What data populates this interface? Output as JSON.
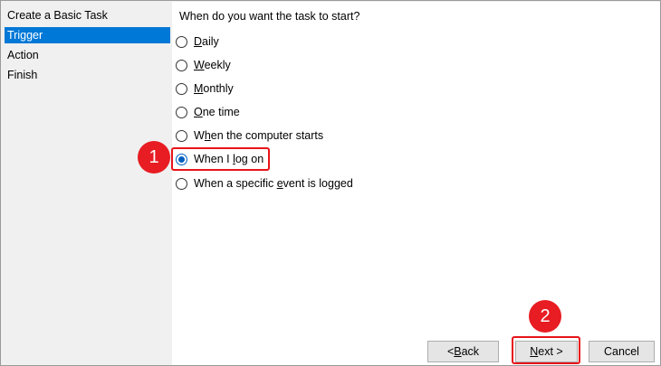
{
  "sidebar": {
    "items": [
      {
        "label": "Create a Basic Task"
      },
      {
        "label": "Trigger"
      },
      {
        "label": "Action"
      },
      {
        "label": "Finish"
      }
    ]
  },
  "main": {
    "question": "When do you want the task to start?",
    "options": [
      {
        "pre": "",
        "u": "D",
        "post": "aily"
      },
      {
        "pre": "",
        "u": "W",
        "post": "eekly"
      },
      {
        "pre": "",
        "u": "M",
        "post": "onthly"
      },
      {
        "pre": "",
        "u": "O",
        "post": "ne time"
      },
      {
        "pre": "W",
        "u": "h",
        "post": "en the computer starts"
      },
      {
        "pre": "When I ",
        "u": "l",
        "post": "og on"
      },
      {
        "pre": "When a specific ",
        "u": "e",
        "post": "vent is logged"
      }
    ],
    "selected_option": "When I log on"
  },
  "annotations": {
    "badge1": "1",
    "badge2": "2",
    "color": "#e8141a"
  },
  "buttons": {
    "back": {
      "pre": "< ",
      "u": "B",
      "post": "ack"
    },
    "next": {
      "pre": "",
      "u": "N",
      "post": "ext >"
    },
    "cancel": "Cancel"
  }
}
